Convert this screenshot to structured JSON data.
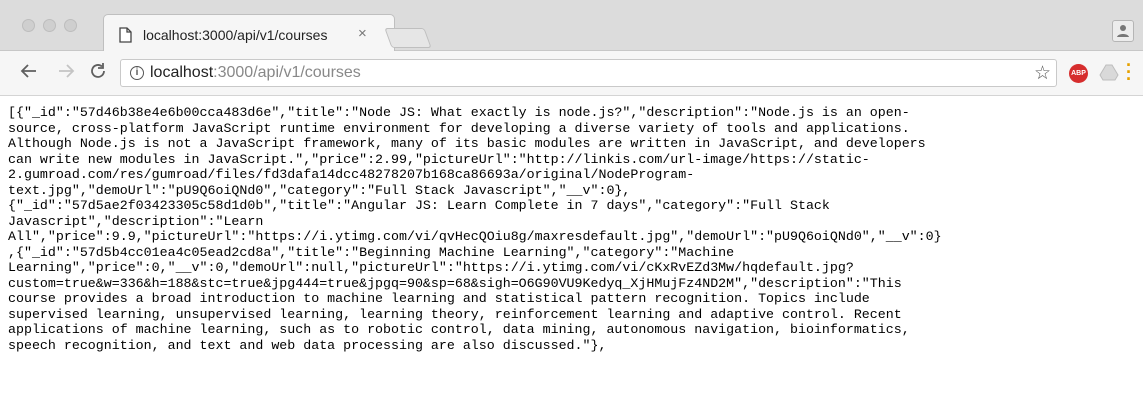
{
  "tab": {
    "title": "localhost:3000/api/v1/courses"
  },
  "address_bar": {
    "host": "localhost",
    "path": ":3000/api/v1/courses"
  },
  "icons": {
    "back": "arrow-left-icon",
    "forward": "arrow-right-icon",
    "reload": "reload-icon",
    "info": "info-icon",
    "bookmark": "star-icon",
    "adblock": "abp-icon",
    "extension": "drive-icon",
    "menu": "kebab-menu-icon",
    "profile": "person-icon"
  },
  "colors": {
    "adblock": "#d62d2d",
    "menu": "#e6a100"
  },
  "response_lines": [
    "[{\"_id\":\"57d46b38e4e6b00cca483d6e\",\"title\":\"Node JS: What exactly is node.js?\",\"description\":\"Node.js is an open-",
    "source, cross-platform JavaScript runtime environment for developing a diverse variety of tools and applications.",
    "Although Node.js is not a JavaScript framework, many of its basic modules are written in JavaScript, and developers",
    "can write new modules in JavaScript.\",\"price\":2.99,\"pictureUrl\":\"http://linkis.com/url-image/https://static-",
    "2.gumroad.com/res/gumroad/files/fd3dafa14dcc48278207b168ca86693a/original/NodeProgram-",
    "text.jpg\",\"demoUrl\":\"pU9Q6oiQNd0\",\"category\":\"Full Stack Javascript\",\"__v\":0},",
    "{\"_id\":\"57d5ae2f03423305c58d1d0b\",\"title\":\"Angular JS: Learn Complete in 7 days\",\"category\":\"Full Stack",
    "Javascript\",\"description\":\"Learn",
    "All\",\"price\":9.9,\"pictureUrl\":\"https://i.ytimg.com/vi/qvHecQOiu8g/maxresdefault.jpg\",\"demoUrl\":\"pU9Q6oiQNd0\",\"__v\":0}",
    ",{\"_id\":\"57d5b4cc01ea4c05ead2cd8a\",\"title\":\"Beginning Machine Learning\",\"category\":\"Machine",
    "Learning\",\"price\":0,\"__v\":0,\"demoUrl\":null,\"pictureUrl\":\"https://i.ytimg.com/vi/cKxRvEZd3Mw/hqdefault.jpg?",
    "custom=true&w=336&h=188&stc=true&jpg444=true&jpgq=90&sp=68&sigh=O6G90VU9Kedyq_XjHMujFz4ND2M\",\"description\":\"This",
    "course provides a broad introduction to machine learning and statistical pattern recognition. Topics include",
    "supervised learning, unsupervised learning, learning theory, reinforcement learning and adaptive control. Recent",
    "applications of machine learning, such as to robotic control, data mining, autonomous navigation, bioinformatics,",
    "speech recognition, and text and web data processing are also discussed.\"},"
  ],
  "abp_label": "ABP"
}
